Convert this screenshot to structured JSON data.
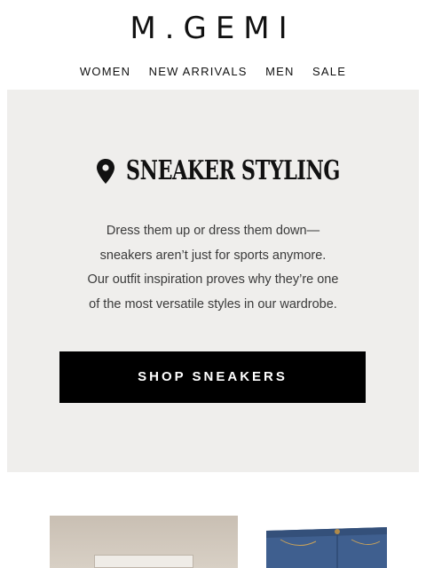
{
  "brand": {
    "logo": "M.GEMI"
  },
  "nav": {
    "items": [
      "WOMEN",
      "NEW ARRIVALS",
      "MEN",
      "SALE"
    ]
  },
  "hero": {
    "title": "SNEAKER STYLING",
    "icon": "location-pin-icon",
    "body_lines": [
      "Dress them up or dress them down—",
      "sneakers aren’t just for sports anymore.",
      "Our outfit inspiration proves why they’re one",
      "of the most versatile styles in our wardrobe."
    ],
    "cta_label": "SHOP SNEAKERS"
  },
  "colors": {
    "hero_bg": "#efeeec",
    "cta_bg": "#000000",
    "cta_text": "#ffffff",
    "jeans": "#3f5f8f"
  }
}
